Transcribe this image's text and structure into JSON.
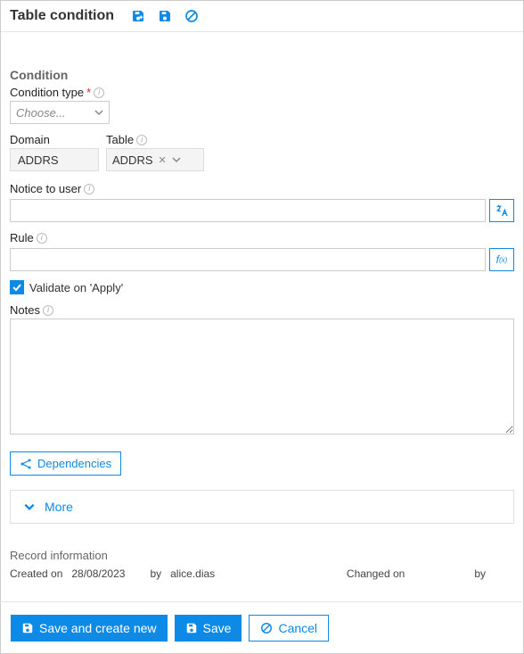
{
  "header": {
    "title": "Table condition"
  },
  "section": {
    "heading": "Condition",
    "condition_type_label": "Condition type",
    "condition_type_placeholder": "Choose...",
    "domain_label": "Domain",
    "domain_value": "ADDRS",
    "table_label": "Table",
    "table_value": "ADDRS",
    "notice_label": "Notice to user",
    "notice_value": "",
    "rule_label": "Rule",
    "rule_value": "",
    "validate_label": "Validate on 'Apply'",
    "validate_checked": true,
    "notes_label": "Notes",
    "notes_value": "",
    "dependencies_label": "Dependencies",
    "more_label": "More"
  },
  "record": {
    "heading": "Record information",
    "created_on_label": "Created on",
    "created_on_value": "28/08/2023",
    "created_by_label": "by",
    "created_by_value": "alice.dias",
    "changed_on_label": "Changed on",
    "changed_on_value": "",
    "changed_by_label": "by",
    "changed_by_value": ""
  },
  "footer": {
    "save_new_label": "Save and create new",
    "save_label": "Save",
    "cancel_label": "Cancel"
  }
}
